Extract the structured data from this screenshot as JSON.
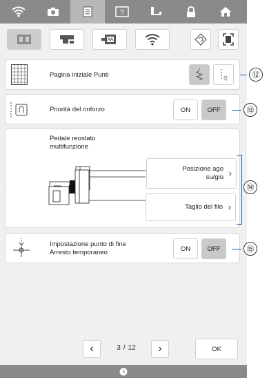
{
  "top_icons": [
    "wifi-icon",
    "camera-icon",
    "document-icon",
    "help-icon",
    "thread-icon",
    "lock-icon",
    "home-icon"
  ],
  "tabs": [
    "machine-settings-icon",
    "sewing-settings-icon",
    "embroidery-settings-icon",
    "wireless-icon"
  ],
  "settings": {
    "start_page_label": "Pagina iniziale Punti",
    "reinforce_label": "Priorità del rinforzo",
    "reinforce_on": "ON",
    "reinforce_off": "OFF",
    "pedal_label_line1": "Pedale reostato",
    "pedal_label_line2": "multifunzione",
    "needle_pos_line1": "Posizione ago",
    "needle_pos_line2": "su/giù",
    "thread_cut": "Taglio del filo",
    "end_point_line1": "Impostazione punto di fine",
    "end_point_line2": "Arresto temporaneo",
    "end_point_on": "ON",
    "end_point_off": "OFF"
  },
  "callouts": {
    "c12": "⑫",
    "c13": "⑬",
    "c14": "⑭",
    "c15": "⑮"
  },
  "pagination": {
    "current": "3",
    "separator": "/",
    "total": "12",
    "ok": "OK"
  },
  "colors": {
    "selected": "#c9c9c9",
    "callout_line": "#1a5fb4"
  }
}
